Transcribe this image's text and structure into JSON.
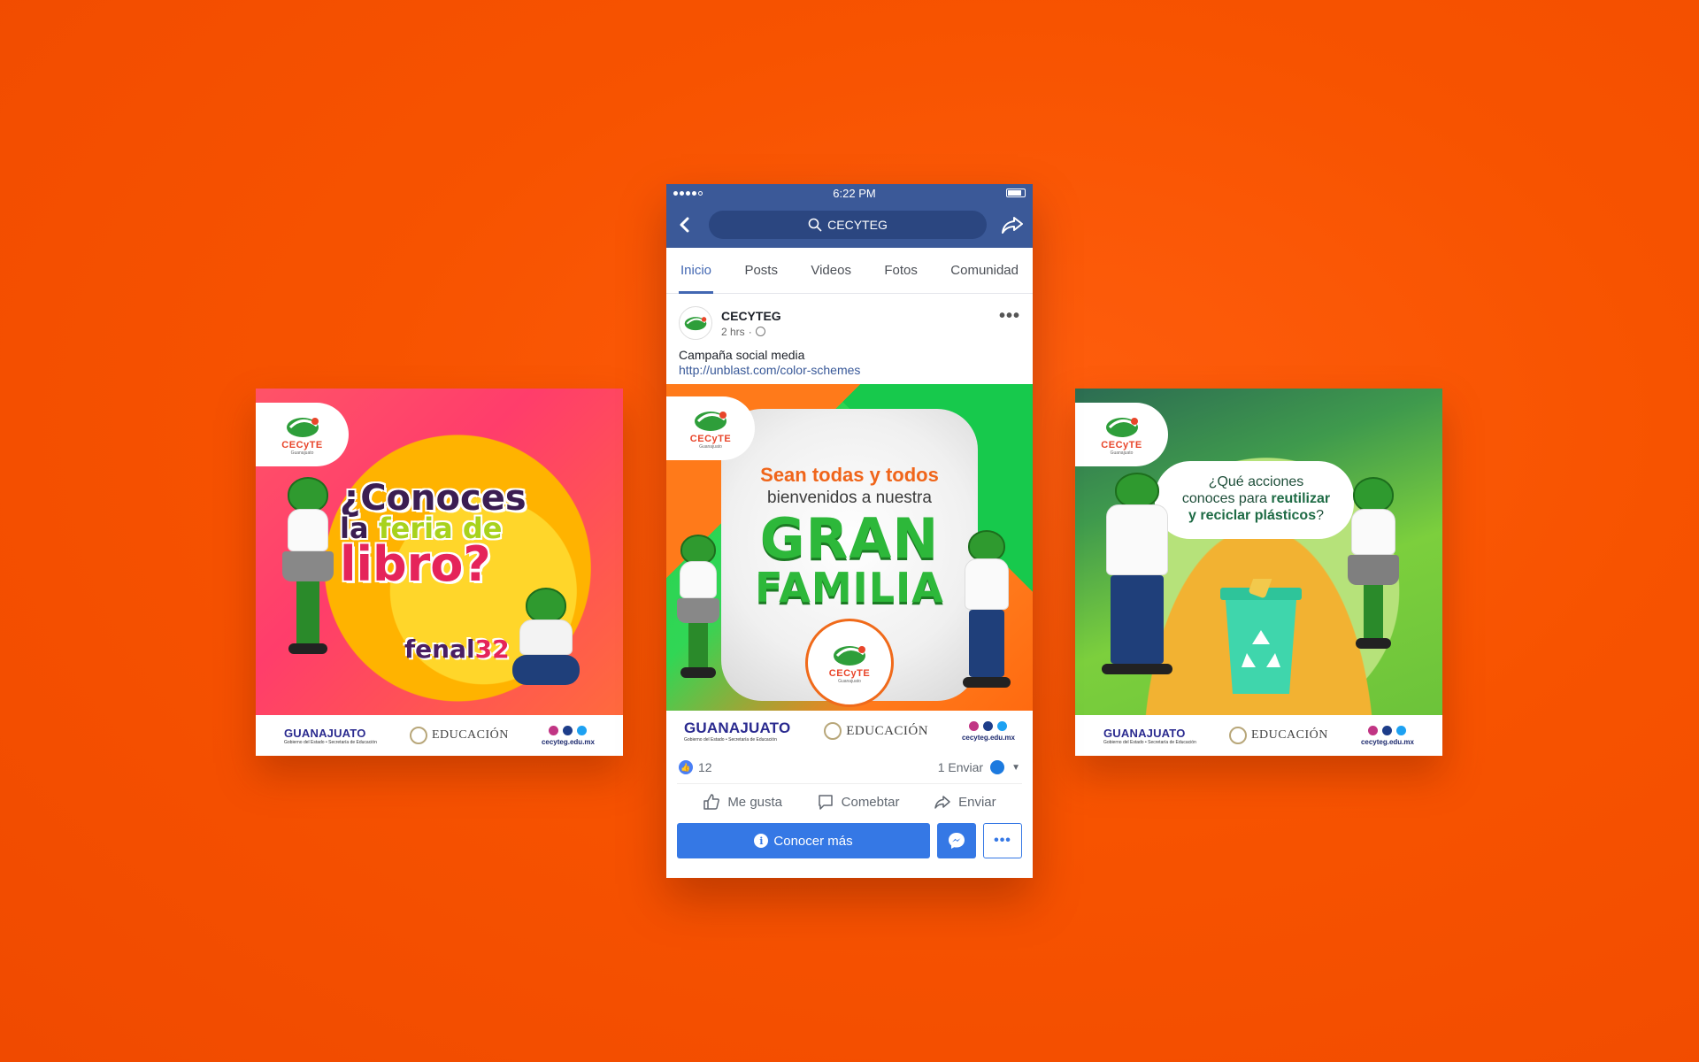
{
  "colors": {
    "background": "#f75300",
    "facebook_blue": "#3b5998",
    "cta_blue": "#3578e5",
    "brand_green": "#2db83a",
    "brand_orange": "#f0651a"
  },
  "status_bar": {
    "time": "6:22 PM"
  },
  "header": {
    "search_text": "CECYTEG",
    "back_icon": "chevron-left-icon",
    "share_icon": "share-icon"
  },
  "tabs": [
    {
      "label": "Inicio",
      "active": true
    },
    {
      "label": "Posts",
      "active": false
    },
    {
      "label": "Videos",
      "active": false
    },
    {
      "label": "Fotos",
      "active": false
    },
    {
      "label": "Comunidad",
      "active": false
    }
  ],
  "post": {
    "page_name": "CECYTEG",
    "time": "2 hrs",
    "text": "Campaña social media",
    "link": "http://unblast.com/color-schemes",
    "likes": "12",
    "shares": "1 Enviar",
    "actions": {
      "like": "Me gusta",
      "comment": "Comebtar",
      "share": "Enviar"
    },
    "cta": "Conocer más"
  },
  "brand": {
    "logo_text": "CECyTE",
    "logo_sub": "Guanajuato",
    "footer_gto": "GUANAJUATO",
    "footer_gto_sub": "Gobierno del Estado • Secretaría de Educación",
    "footer_edu": "EDUCACIÓN",
    "footer_site": "cecyteg.edu.mx"
  },
  "card_left": {
    "line1": "¿Conoces",
    "line2_a": "la ",
    "line2_b": "feria de",
    "line3": "libro?",
    "fenal_a": "fenal",
    "fenal_b": "32"
  },
  "card_center": {
    "line1": "Sean todas y todos",
    "line2": "bienvenidos a nuestra",
    "line3": "GRAN",
    "line4": "FAMILIA"
  },
  "card_right": {
    "q1": "¿Qué acciones",
    "q2": "conoces para ",
    "q2_bold": "reutilizar",
    "q3_bold": "y reciclar plásticos",
    "q3_end": "?"
  }
}
